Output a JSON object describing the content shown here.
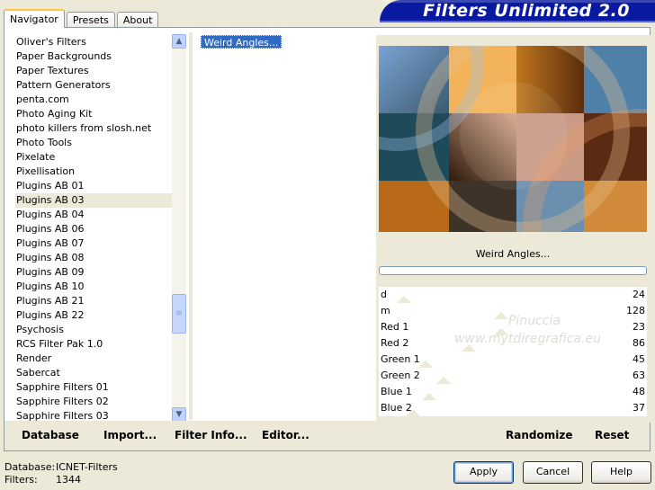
{
  "tabs": [
    "Navigator",
    "Presets",
    "About"
  ],
  "brand": "Filters Unlimited 2.0",
  "categories": [
    "Oliver's Filters",
    "Paper Backgrounds",
    "Paper Textures",
    "Pattern Generators",
    "penta.com",
    "Photo Aging Kit",
    "photo killers from slosh.net",
    "Photo Tools",
    "Pixelate",
    "Pixellisation",
    "Plugins AB 01",
    "Plugins AB 03",
    "Plugins AB 04",
    "Plugins AB 06",
    "Plugins AB 07",
    "Plugins AB 08",
    "Plugins AB 09",
    "Plugins AB 10",
    "Plugins AB 21",
    "Plugins AB 22",
    "Psychosis",
    "RCS Filter Pak 1.0",
    "Render",
    "Sabercat",
    "Sapphire Filters 01",
    "Sapphire Filters 02",
    "Sapphire Filters 03"
  ],
  "selected_category": "Plugins AB 03",
  "filters": [
    "Weird Angles..."
  ],
  "filter_title": "Weird Angles...",
  "params": [
    {
      "label": "d",
      "value": "24"
    },
    {
      "label": "m",
      "value": "128"
    },
    {
      "label": "Red 1",
      "value": "23"
    },
    {
      "label": "Red 2",
      "value": "86"
    },
    {
      "label": "Green 1",
      "value": "45"
    },
    {
      "label": "Green 2",
      "value": "63"
    },
    {
      "label": "Blue 1",
      "value": "48"
    },
    {
      "label": "Blue 2",
      "value": "37"
    }
  ],
  "watermark": [
    "Pinuccia",
    "www.mytdiregrafica.eu"
  ],
  "bottom_left_buttons": [
    "Database",
    "Import...",
    "Filter Info...",
    "Editor..."
  ],
  "bottom_right_buttons": [
    "Randomize",
    "Reset"
  ],
  "info": {
    "database_label": "Database:",
    "database_value": "ICNET-Filters",
    "filters_label": "Filters:",
    "filters_value": "1344"
  },
  "dialog_buttons": {
    "apply": "Apply",
    "cancel": "Cancel",
    "help": "Help"
  },
  "colors": {
    "accent": "#316ac5",
    "brand_bg": "#0a1aa0",
    "dialog_bg": "#ece9d8"
  }
}
